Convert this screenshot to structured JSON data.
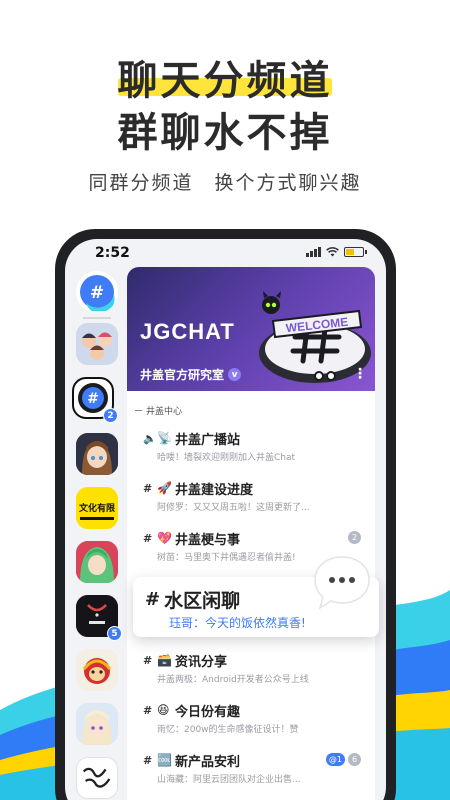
{
  "promo": {
    "headline_1": "聊天分频道",
    "headline_2": "群聊水不掉",
    "tagline": "同群分频道　换个方式聊兴趣"
  },
  "colors": {
    "highlight": "#ffe53b",
    "accent_blue": "#3f7cf5",
    "banner_purple": "#5a3fa8",
    "wave_yellow": "#ffd400",
    "wave_blue": "#2f7cf6",
    "wave_cyan": "#3ad0e8"
  },
  "status": {
    "time": "2:52"
  },
  "rail": {
    "items": [
      {
        "name": "home-logo-icon"
      },
      {
        "name": "anime-group-avatar"
      },
      {
        "name": "jgchat-group-avatar",
        "badge": "2"
      },
      {
        "name": "anime-girl-avatar"
      },
      {
        "name": "culture-avatar",
        "text": "文化有限"
      },
      {
        "name": "green-hair-avatar"
      },
      {
        "name": "dark-avatar",
        "badge": "5"
      },
      {
        "name": "monkey-avatar"
      },
      {
        "name": "genshin-avatar"
      },
      {
        "name": "calligraphy-avatar"
      }
    ]
  },
  "server": {
    "banner_title": "JGCHAT",
    "welcome": "WELCOME",
    "name": "井盖官方研究室",
    "verified_mark": "v",
    "section": "井盖中心"
  },
  "channels": [
    {
      "emoji": "📡",
      "name": "井盖广播站",
      "preview": "哈喽！墙裂欢迎刚刚加入井盖Chat",
      "prefix": "speaker"
    },
    {
      "emoji": "🚀",
      "name": "井盖建设进度",
      "preview": "阿修罗：又又又周五啦！这周更新了..."
    },
    {
      "emoji": "💖",
      "name": "井盖梗与事",
      "preview": "树苗：马里奥下井偶遇忍者偷井盖!",
      "badge": "2"
    },
    {
      "emoji": "",
      "name": "水区闲聊",
      "preview": "珏哥：今天的饭依然真香!"
    },
    {
      "emoji": "🗃️",
      "name": "资讯分享",
      "preview": "井盖两极：Android开发者公众号上线"
    },
    {
      "emoji": "😆",
      "name": "今日份有趣",
      "preview": "雨忆：200w的生命感像征设计！赞"
    },
    {
      "emoji": "🆒",
      "name": "新产品安利",
      "preview": "山海藏：阿里云团团队对企业出售...",
      "at": "@1",
      "badge": "6"
    }
  ]
}
